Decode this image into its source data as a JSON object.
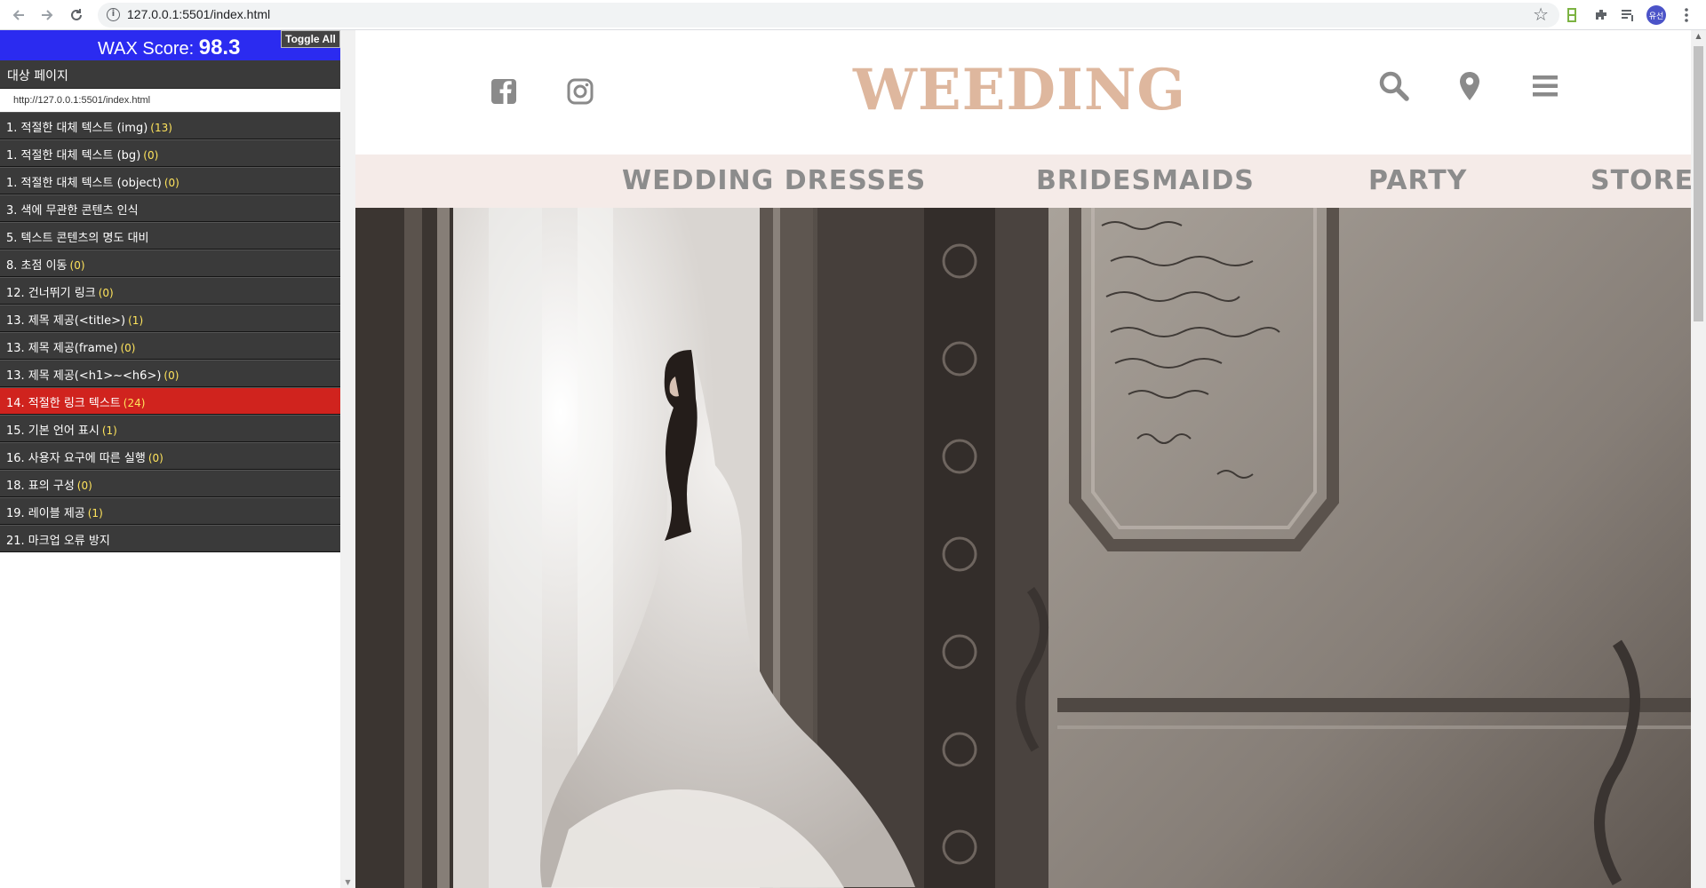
{
  "browser": {
    "url": "127.0.0.1:5501/index.html",
    "back_icon": "arrow-left-icon",
    "forward_icon": "arrow-right-icon",
    "reload_icon": "reload-icon",
    "profile_label": "유선"
  },
  "wax": {
    "score_label": "WAX Score: ",
    "score_value": "98.3",
    "toggle_label": "Toggle All",
    "target_title": "대상 페이지",
    "target_url": "http://127.0.0.1:5501/index.html",
    "items": [
      {
        "label": "1. 적절한 대체 텍스트 (img)",
        "count": "(13)",
        "active": false
      },
      {
        "label": "1. 적절한 대체 텍스트 (bg)",
        "count": "(0)",
        "active": false
      },
      {
        "label": "1. 적절한 대체 텍스트 (object)",
        "count": "(0)",
        "active": false
      },
      {
        "label": "3. 색에 무관한 콘텐츠 인식",
        "count": "",
        "active": false
      },
      {
        "label": "5. 텍스트 콘텐츠의 명도 대비",
        "count": "",
        "active": false
      },
      {
        "label": "8. 초점 이동",
        "count": "(0)",
        "active": false
      },
      {
        "label": "12. 건너뛰기 링크",
        "count": "(0)",
        "active": false
      },
      {
        "label": "13. 제목 제공(<title>)",
        "count": "(1)",
        "active": false
      },
      {
        "label": "13. 제목 제공(frame)",
        "count": "(0)",
        "active": false
      },
      {
        "label": "13. 제목 제공(<h1>~<h6>)",
        "count": "(0)",
        "active": false
      },
      {
        "label": "14. 적절한 링크 텍스트",
        "count": "(24)",
        "active": true
      },
      {
        "label": "15. 기본 언어 표시",
        "count": "(1)",
        "active": false
      },
      {
        "label": "16. 사용자 요구에 따른 실행",
        "count": "(0)",
        "active": false
      },
      {
        "label": "18. 표의 구성",
        "count": "(0)",
        "active": false
      },
      {
        "label": "19. 레이블 제공",
        "count": "(1)",
        "active": false
      },
      {
        "label": "21. 마크업 오류 방지",
        "count": "",
        "active": false
      }
    ]
  },
  "site": {
    "logo": "WEEDING",
    "social_icons": [
      "facebook-icon",
      "instagram-icon"
    ],
    "header_icons": [
      "search-icon",
      "map-pin-icon",
      "hamburger-menu-icon"
    ],
    "nav": [
      "WEDDING DRESSES",
      "BRIDESMAIDS",
      "PARTY",
      "STORE"
    ],
    "colors": {
      "logo": "#deb79e",
      "nav_bg": "#f5ebe8",
      "nav_text": "#8c8c8c",
      "wax_header": "#2b2bf0",
      "wax_active": "#d0231e",
      "wax_count": "#ffe45c"
    }
  }
}
